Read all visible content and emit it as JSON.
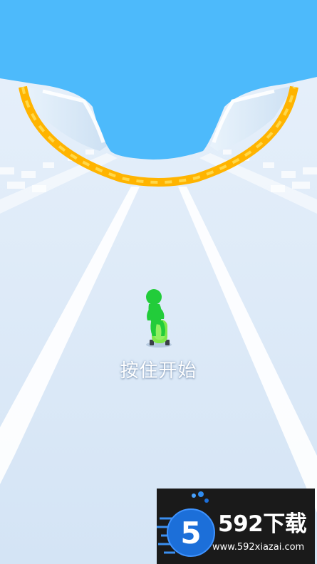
{
  "game": {
    "start_hint": "按住开始"
  },
  "watermark": {
    "logo_digit": "5",
    "brand": "592下载",
    "url": "www.592xiazai.com"
  },
  "colors": {
    "sky": "#4dbafb",
    "track": "#dce8f6",
    "rail": "#ffb400",
    "rail_light": "#ffd84a",
    "player": "#22cc3a",
    "skateboard": "#7ee84a",
    "watermark_bg": "#1a1a1a",
    "logo_blue": "#1c6fd9"
  },
  "icons": {
    "player": "stick-figure-on-skateboard",
    "logo": "592-circle-logo"
  }
}
